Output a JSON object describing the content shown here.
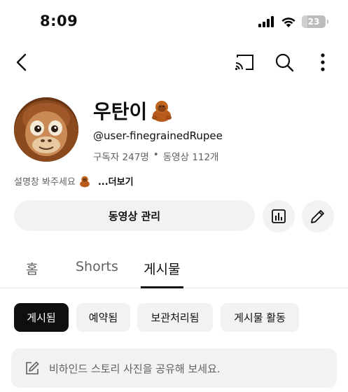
{
  "status_bar": {
    "time": "8:09",
    "battery": "23",
    "battery_level": 0.23
  },
  "channel": {
    "name": "우탄이",
    "handle": "@user-finegrainedRupee",
    "subscribers": "구독자 247명",
    "separator": "•",
    "videos": "동영상 112개",
    "description": "설명창 봐주세요",
    "more_label": "...더보기"
  },
  "actions": {
    "manage_label": "동영상 관리"
  },
  "tabs": [
    {
      "label": "홈"
    },
    {
      "label": "Shorts"
    },
    {
      "label": "게시물"
    }
  ],
  "chips": [
    {
      "label": "게시됨"
    },
    {
      "label": "예약됨"
    },
    {
      "label": "보관처리됨"
    },
    {
      "label": "게시물 활동"
    }
  ],
  "composer": {
    "placeholder": "비하인드 스토리 사진을 공유해 보세요."
  },
  "colors": {
    "text": "#0f0f0f",
    "secondary": "#606060",
    "chip_bg": "#f2f2f2",
    "active": "#0f0f0f"
  },
  "icons": [
    "back-icon",
    "cast-icon",
    "search-icon",
    "more-vert-icon",
    "orangutan-emoji-icon",
    "analytics-icon",
    "pencil-icon",
    "edit-post-icon"
  ]
}
